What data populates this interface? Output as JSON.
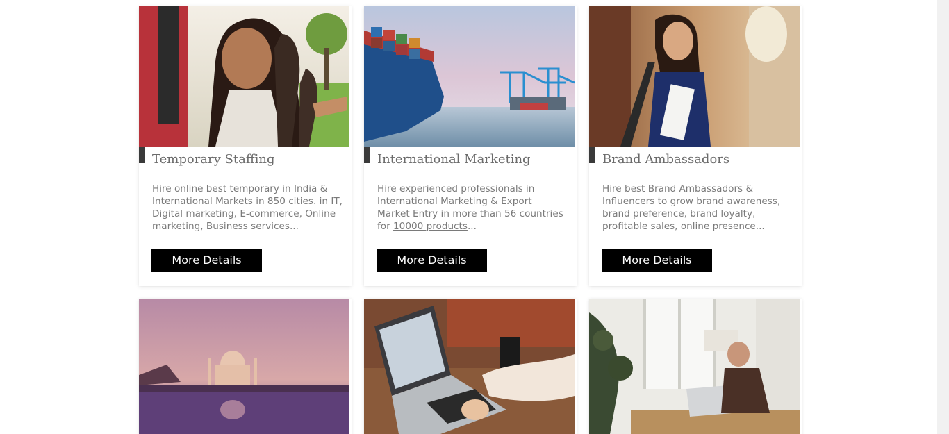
{
  "cards": [
    {
      "title": "Temporary Staffing",
      "desc_lines": [
        "Hire online best temporary in India &",
        "International Markets in 850 cities. in IT,",
        "Digital marketing, E-commerce, Online",
        "marketing, Business services..."
      ],
      "button": "More Details"
    },
    {
      "title": "International Marketing",
      "desc_lines": [
        "Hire experienced professionals in",
        "International Marketing & Export",
        "Market Entry in more than 56 countries"
      ],
      "desc_last_prefix": "for ",
      "desc_last_link": "10000 products",
      "desc_last_suffix": "...",
      "button": "More Details"
    },
    {
      "title": "Brand Ambassadors",
      "desc_lines": [
        "Hire best Brand Ambassadors &",
        "Influencers to grow brand awareness,",
        "brand preference, brand loyalty,",
        "profitable sales, online presence..."
      ],
      "button": "More Details"
    }
  ],
  "colors": {
    "button_bg": "#000000",
    "button_text": "#ffffff",
    "title": "#6b6b6b",
    "desc": "#7a7a7a"
  }
}
